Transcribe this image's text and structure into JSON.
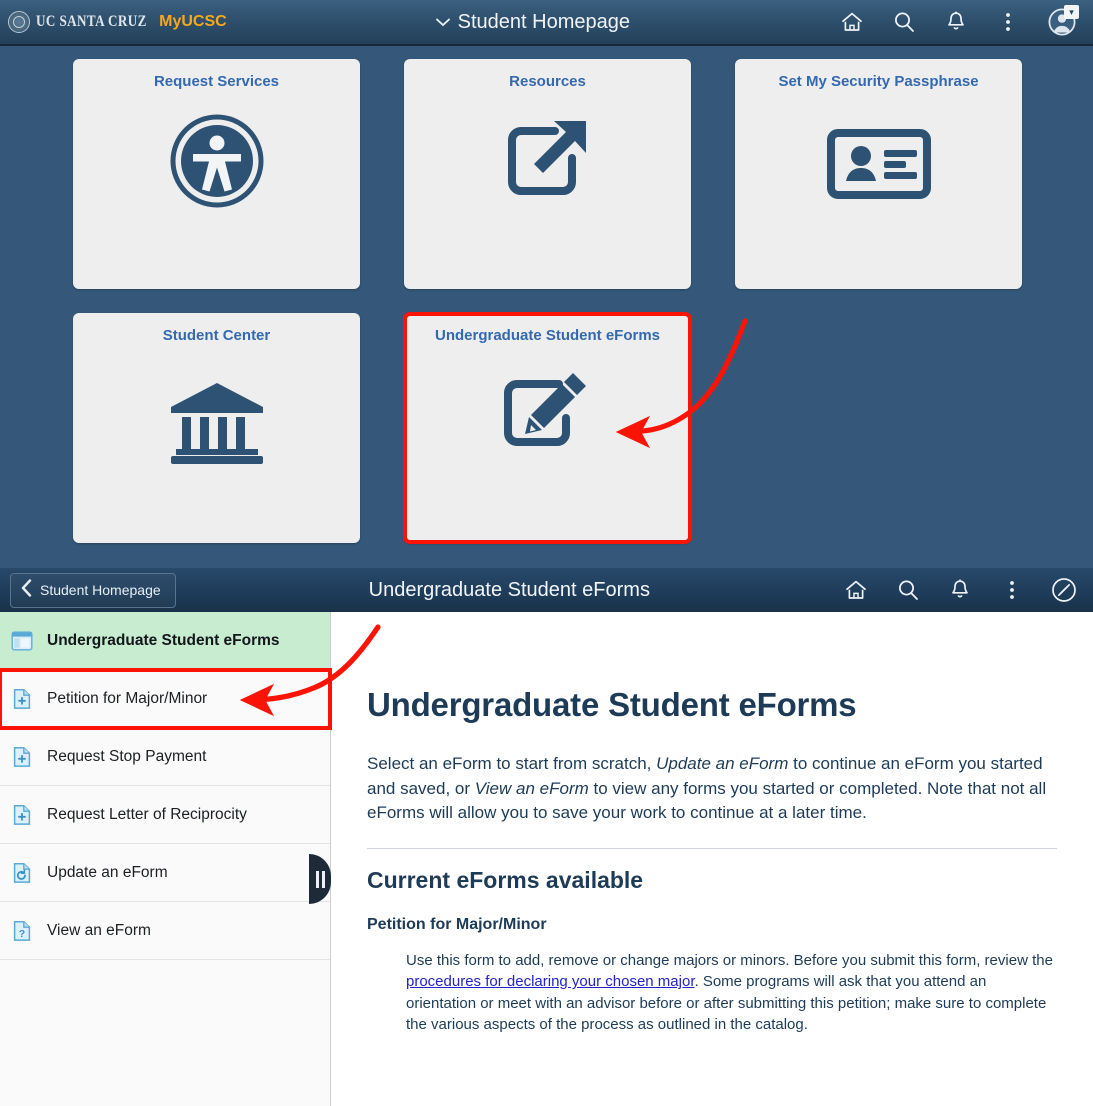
{
  "top_header": {
    "brand_uc": "UC SANTA CRUZ",
    "brand_my": "MyUCSC",
    "title": "Student Homepage",
    "chevron": "⌄",
    "icons": [
      "home-icon",
      "search-icon",
      "notifications-bell-icon",
      "actions-kebab-icon",
      "profile-avatar-icon"
    ]
  },
  "homepage_tiles": [
    {
      "title": "Request Services",
      "icon": "accessibility-icon",
      "highlighted": false
    },
    {
      "title": "Resources",
      "icon": "external-link-icon",
      "highlighted": false
    },
    {
      "title": "Set My Security Passphrase",
      "icon": "id-card-icon",
      "highlighted": false
    },
    {
      "title": "Student Center",
      "icon": "bank-building-icon",
      "highlighted": false
    },
    {
      "title": "Undergraduate Student eForms",
      "icon": "edit-form-pencil-icon",
      "highlighted": true
    }
  ],
  "sub_header": {
    "back_label": "Student Homepage",
    "title": "Undergraduate Student eForms",
    "icons": [
      "home-icon",
      "search-icon",
      "notifications-bell-icon",
      "actions-kebab-icon",
      "compass-icon"
    ]
  },
  "sidebar": {
    "items": [
      {
        "label": "Undergraduate Student eForms",
        "icon": "form-window-icon",
        "active": true,
        "boxed": false
      },
      {
        "label": "Petition for Major/Minor",
        "icon": "document-add-icon",
        "active": false,
        "boxed": true
      },
      {
        "label": "Request Stop Payment",
        "icon": "document-add-icon",
        "active": false,
        "boxed": false
      },
      {
        "label": "Request Letter of Reciprocity",
        "icon": "document-add-icon",
        "active": false,
        "boxed": false
      },
      {
        "label": "Update an eForm",
        "icon": "document-refresh-icon",
        "active": false,
        "boxed": false
      },
      {
        "label": "View an eForm",
        "icon": "document-question-icon",
        "active": false,
        "boxed": false
      }
    ],
    "collapse_handle": "sidebar-collapse-handle"
  },
  "content": {
    "heading": "Undergraduate Student eForms",
    "lead_part1": "Select an eForm to start from scratch, ",
    "lead_em1": "Update an eForm",
    "lead_part2": " to continue an eForm you started and saved, or ",
    "lead_em2": "View an eForm",
    "lead_part3": " to view any forms you started or completed. Note that not all eForms will allow you to save your work to continue at a later time.",
    "section_heading": "Current eForms available",
    "subsection_heading": "Petition for Major/Minor",
    "body_part1": "Use this form to add, remove or change majors or minors. Before you submit this form, review the ",
    "body_link": "procedures for declaring your chosen major",
    "body_part2": ". Some programs will ask that you attend an orientation or meet with an advisor before or after submitting this petition; make sure to complete the various aspects of the process as outlined in the catalog."
  },
  "annotations": {
    "arrow_to_tile": "red-arrow-pointing-to-eforms-tile",
    "arrow_to_sidebar_item": "red-arrow-pointing-to-petition-item",
    "highlight_color": "#fb1405"
  },
  "colors": {
    "page_background": "#35587a",
    "header_gradient_top": "#3c6080",
    "tile_background": "#eeeeee",
    "tile_title": "#3469b0",
    "icon_navy": "#2e5273",
    "active_sidebar": "#c8ecd0",
    "heading_navy": "#1d3b57",
    "link_blue": "#2222cc",
    "brand_gold": "#f5a81c"
  }
}
